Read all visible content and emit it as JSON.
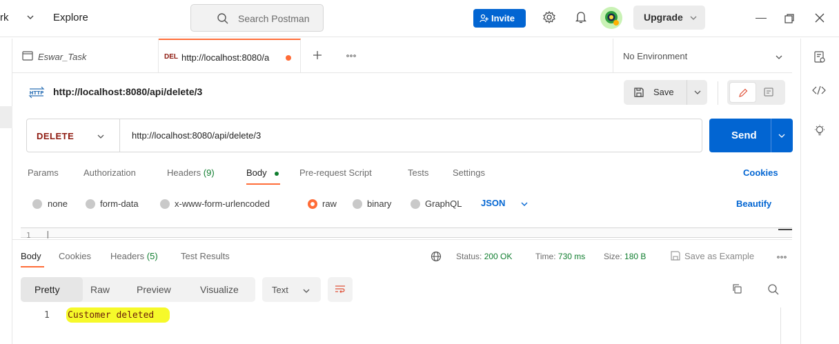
{
  "header": {
    "workspace": "rk",
    "explore": "Explore",
    "search_placeholder": "Search Postman",
    "invite": "Invite",
    "upgrade": "Upgrade"
  },
  "tabs": {
    "workspace_tab": "Eswar_Task",
    "active_method": "DEL",
    "active_url": "http://localhost:8080/a",
    "environment": "No Environment"
  },
  "request": {
    "name": "http://localhost:8080/api/delete/3",
    "save": "Save",
    "method": "DELETE",
    "url": "http://localhost:8080/api/delete/3",
    "send": "Send"
  },
  "request_tabs": {
    "params": "Params",
    "authorization": "Authorization",
    "headers": "Headers",
    "headers_count": "(9)",
    "body": "Body",
    "pre_request": "Pre-request Script",
    "tests": "Tests",
    "settings": "Settings",
    "cookies": "Cookies"
  },
  "body_types": {
    "none": "none",
    "form_data": "form-data",
    "urlencoded": "x-www-form-urlencoded",
    "raw": "raw",
    "binary": "binary",
    "graphql": "GraphQL",
    "format": "JSON",
    "beautify": "Beautify"
  },
  "editor": {
    "line_number": "1",
    "cursor": "|"
  },
  "response_tabs": {
    "body": "Body",
    "cookies": "Cookies",
    "headers": "Headers",
    "headers_count": "(5)",
    "test_results": "Test Results"
  },
  "response_meta": {
    "status_label": "Status:",
    "status_value": "200 OK",
    "time_label": "Time:",
    "time_value": "730 ms",
    "size_label": "Size:",
    "size_value": "180 B",
    "save_example": "Save as Example"
  },
  "response_view": {
    "pretty": "Pretty",
    "raw": "Raw",
    "preview": "Preview",
    "visualize": "Visualize",
    "format": "Text"
  },
  "response_body": {
    "line_number": "1",
    "text": "Customer deleted"
  },
  "colors": {
    "accent": "#ff6c37",
    "primary": "#0265d2",
    "success": "#0f7d2e",
    "delete": "#8e1a10",
    "highlight": "#f6f92a"
  }
}
